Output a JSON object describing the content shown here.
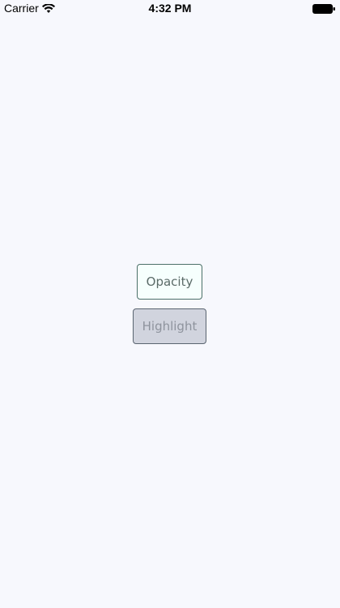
{
  "status_bar": {
    "carrier": "Carrier",
    "time": "4:32 PM",
    "wifi_icon": "wifi-icon",
    "battery_icon": "battery-icon"
  },
  "buttons": {
    "opacity_label": "Opacity",
    "highlight_label": "Highlight"
  },
  "colors": {
    "background": "#f7f8fd",
    "opacity_button_bg": "#f6fffd",
    "opacity_button_border": "#4c6f68",
    "highlight_button_bg": "#d1d4de",
    "highlight_button_border": "#5a6470"
  }
}
